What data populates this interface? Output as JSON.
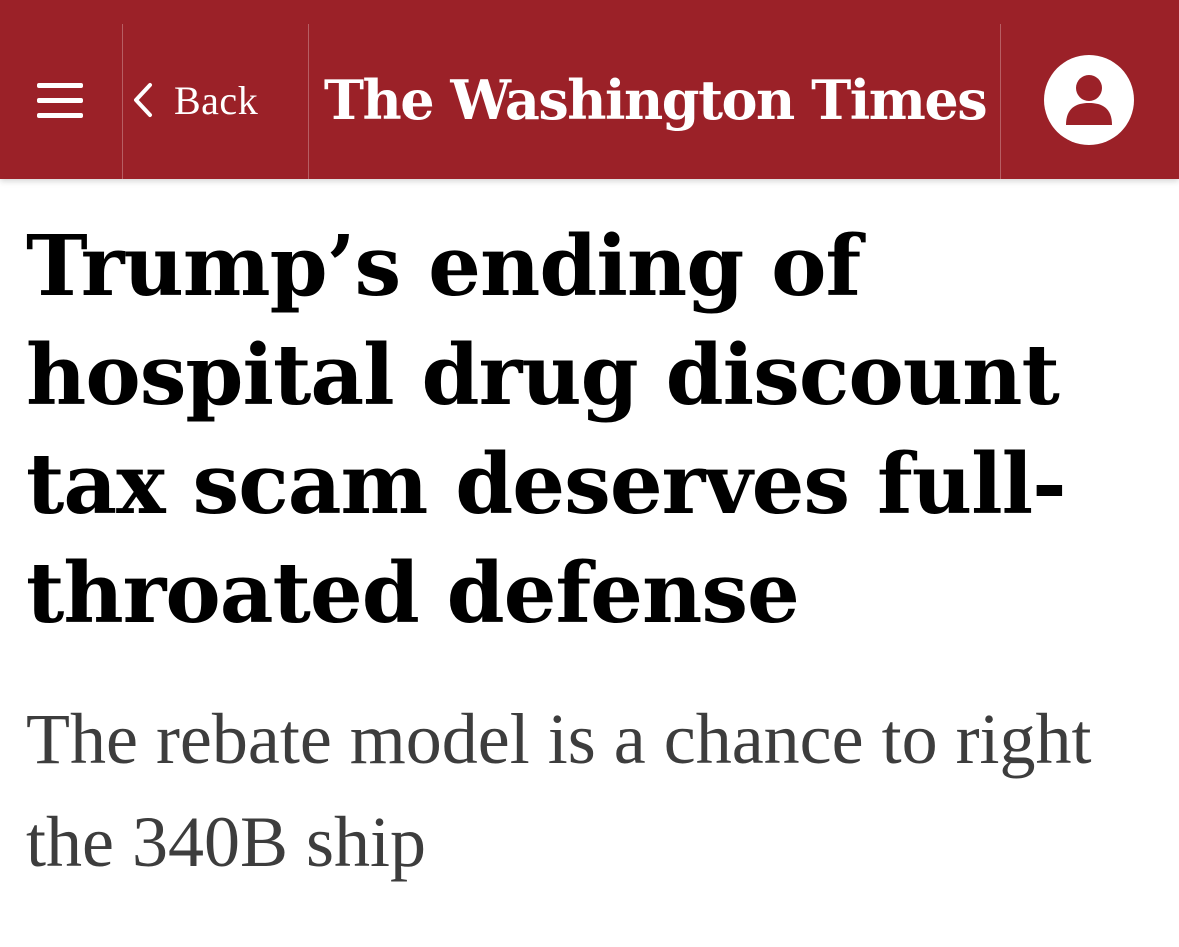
{
  "header": {
    "background_color": "#9b2128",
    "menu_icon": "hamburger-menu-icon",
    "back_icon": "chevron-left-icon",
    "back_label": "Back",
    "masthead": "The Washington Times",
    "account_icon": "user-icon"
  },
  "article": {
    "headline": "Trump’s ending of hospital drug discount tax scam deserves full-throated defense",
    "subheadline": "The rebate model is a chance to right the 340B ship"
  }
}
